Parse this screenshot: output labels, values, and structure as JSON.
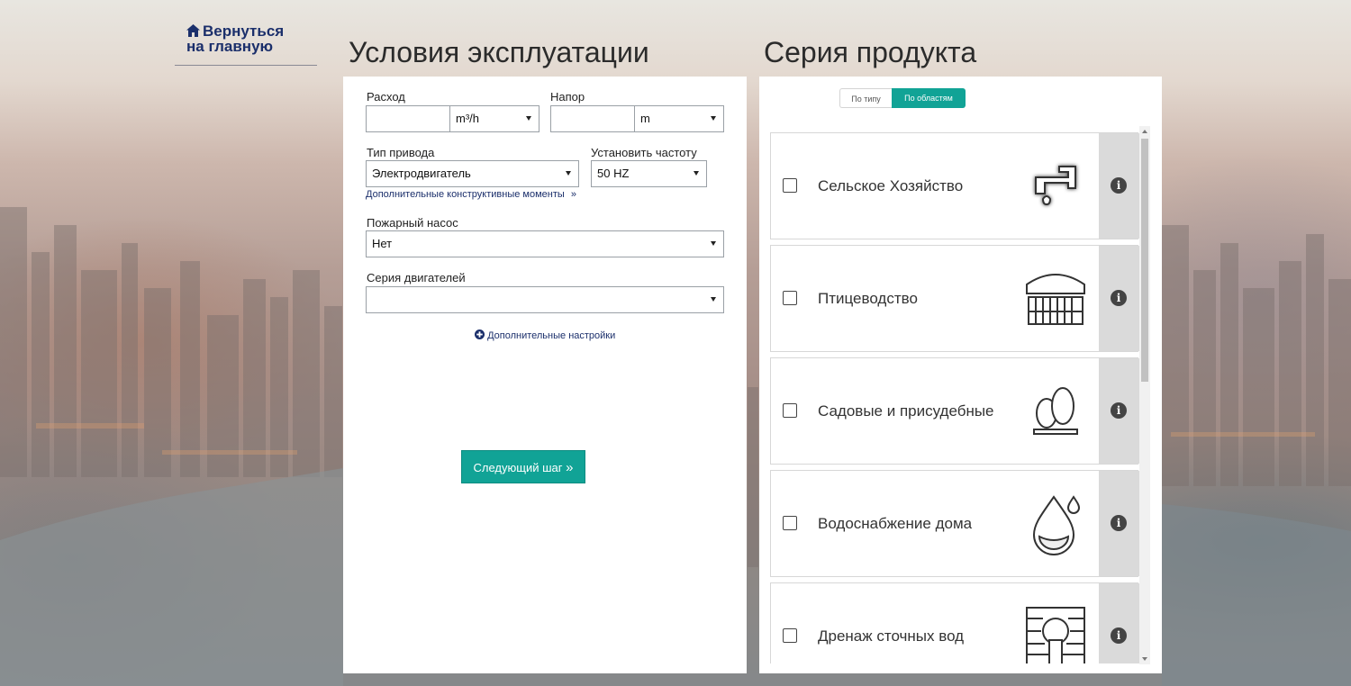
{
  "nav": {
    "back_label_line1": "Вернуться",
    "back_label_line2": "на главную"
  },
  "left": {
    "title": "Условия эксплуатации",
    "flow": {
      "label": "Расход",
      "value": "",
      "unit": "m³/h"
    },
    "head": {
      "label": "Напор",
      "value": "",
      "unit": "m"
    },
    "drive": {
      "label": "Тип привода",
      "value": "Электродвигатель"
    },
    "frequency": {
      "label": "Установить частоту",
      "value": "50 HZ"
    },
    "extra_design_link": "Дополнительные конструктивные моменты",
    "fire_pump": {
      "label": "Пожарный насос",
      "value": "Нет"
    },
    "motor_series": {
      "label": "Серия двигателей",
      "value": ""
    },
    "extra_settings_link": "Дополнительные настройки",
    "next_button": "Следующий шаг"
  },
  "right": {
    "title": "Серия продукта",
    "toggle": {
      "by_type": "По типу",
      "by_area": "По областям",
      "active": "by_area"
    },
    "areas": [
      {
        "name": "Сельское Хозяйство",
        "icon": "faucet-icon",
        "checked": false
      },
      {
        "name": "Птицеводство",
        "icon": "poultry-feeder-icon",
        "checked": false
      },
      {
        "name": "Садовые и присудебные",
        "icon": "trees-icon",
        "checked": false
      },
      {
        "name": "Водоснабжение дома",
        "icon": "water-drop-icon",
        "checked": false
      },
      {
        "name": "Дренаж сточных вод",
        "icon": "drainage-pipe-icon",
        "checked": false
      }
    ]
  },
  "colors": {
    "accent": "#11a396",
    "link": "#1b2f6b"
  }
}
